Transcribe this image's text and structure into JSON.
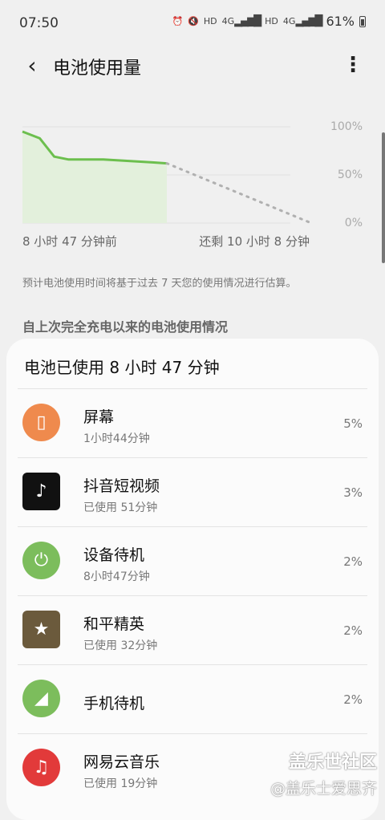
{
  "status_bar": {
    "time": "07:50",
    "icons": [
      "alarm-icon",
      "mute-icon",
      "hd-icon",
      "4g-signal-icon",
      "hd-icon",
      "4g-signal-icon",
      "battery-icon"
    ],
    "hd1": "HD",
    "lte1": "4G",
    "hd2": "HD",
    "lte2": "4G",
    "battery": "61%"
  },
  "app_bar": {
    "title": "电池使用量",
    "back_icon": "back-arrow-icon",
    "more_icon": "more-vert-icon"
  },
  "chart_data": {
    "type": "line",
    "y_ticks": [
      "100%",
      "50%",
      "0%"
    ],
    "ylim": [
      0,
      100
    ],
    "x_start_label": "8 小时 47 分钟前",
    "x_end_label": "还剩 10 小时 8 分钟",
    "series": [
      {
        "values": [
          [
            0,
            95
          ],
          [
            0.06,
            88
          ],
          [
            0.11,
            69
          ],
          [
            0.16,
            66
          ],
          [
            0.28,
            66
          ],
          [
            0.45,
            63
          ],
          [
            0.5,
            62
          ]
        ]
      },
      {
        "values": [
          [
            0.5,
            62
          ],
          [
            1,
            0
          ]
        ]
      }
    ],
    "colors": {
      "used": "#6cbf4e",
      "projection": "#b0b0b0",
      "fill": "#e3f0dc"
    }
  },
  "estimate_note": "预计电池使用时间将基于过去 7 天您的使用情况进行估算。",
  "section_header": "自上次完全充电以来的电池使用情况",
  "card": {
    "title": "电池已使用 8 小时 47 分钟",
    "items": [
      {
        "name": "屏幕",
        "sub": "1小时44分钟",
        "pct": "5%",
        "icon": "screen-icon",
        "glyph": "▯"
      },
      {
        "name": "抖音短视频",
        "sub": "已使用 51分钟",
        "pct": "3%",
        "icon": "tiktok-icon",
        "glyph": "♪"
      },
      {
        "name": "设备待机",
        "sub": "8小时47分钟",
        "pct": "2%",
        "icon": "power-icon",
        "glyph": "⏻"
      },
      {
        "name": "和平精英",
        "sub": "已使用 32分钟",
        "pct": "2%",
        "icon": "game-icon",
        "glyph": "★"
      },
      {
        "name": "手机待机",
        "sub": "",
        "pct": "2%",
        "icon": "signal-icon",
        "glyph": "◢"
      },
      {
        "name": "网易云音乐",
        "sub": "已使用 19分钟",
        "pct": "",
        "icon": "music-icon",
        "glyph": "♫"
      }
    ]
  },
  "watermark": {
    "line1": "盖乐世社区",
    "line2": "@盖乐士爱思齐"
  }
}
